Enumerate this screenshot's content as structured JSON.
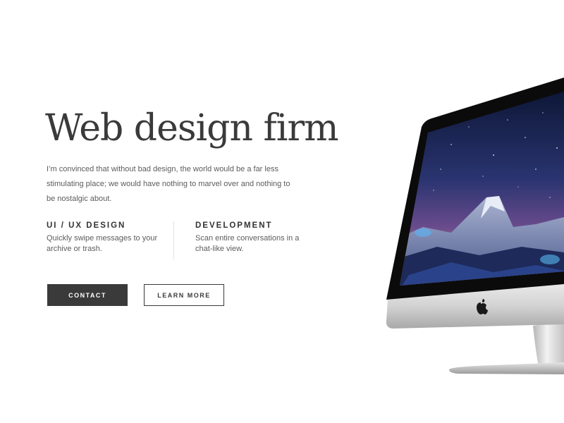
{
  "hero": {
    "title": "Web design firm",
    "description": "I’m convinced that without bad design, the world would be a far less stimulating place; we would have nothing to marvel over and nothing to be nostalgic about."
  },
  "features": [
    {
      "title": "UI / UX DESIGN",
      "text": "Quickly swipe messages to your archive or trash."
    },
    {
      "title": "DEVELOPMENT",
      "text": "Scan entire conversations in a chat-like view."
    }
  ],
  "buttons": {
    "contact_label": "CONTACT",
    "learn_more_label": "LEARN MORE"
  },
  "colors": {
    "text_dark": "#3a3a3a",
    "text_body": "#5c5c5c",
    "button_dark": "#3a3a3a",
    "background": "#ffffff"
  },
  "imagery": {
    "device": "imac",
    "screen_scene": "starry-night-mountain",
    "logo_icon": "apple-logo-icon"
  }
}
